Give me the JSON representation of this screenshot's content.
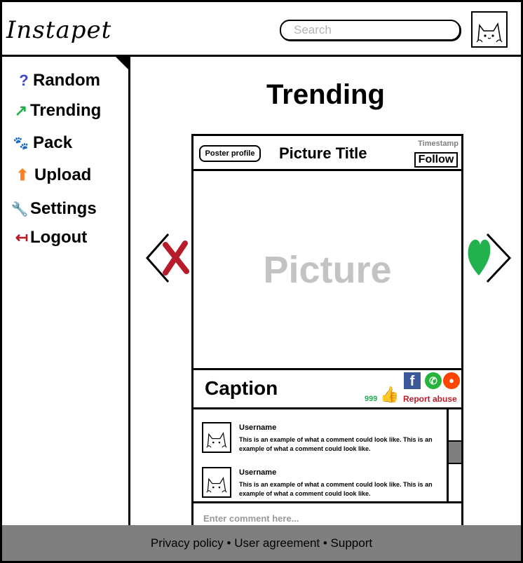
{
  "header": {
    "logo": "Instapet",
    "search_placeholder": "Search"
  },
  "sidebar": {
    "items": [
      {
        "label": "Random",
        "icon": "question-icon",
        "glyph": "?",
        "color": "#3f48cc"
      },
      {
        "label": "Trending",
        "icon": "trending-arrow-icon",
        "glyph": "↗",
        "color": "#22b14c"
      },
      {
        "label": "Pack",
        "icon": "paw-icon",
        "glyph": "🐾",
        "color": "#000000"
      },
      {
        "label": "Upload",
        "icon": "upload-arrow-icon",
        "glyph": "⬆",
        "color": "#ff7f27"
      },
      {
        "label": "Settings",
        "icon": "wrench-icon",
        "glyph": "🔧",
        "color": "#7f7f7f"
      },
      {
        "label": "Logout",
        "icon": "logout-arrow-icon",
        "glyph": "↤",
        "color": "#b61c2a"
      }
    ]
  },
  "main": {
    "title": "Trending"
  },
  "post": {
    "poster_label": "Poster profile",
    "title": "Picture Title",
    "timestamp": "Timestamp",
    "follow_label": "Follow",
    "picture_placeholder": "Picture",
    "caption": "Caption",
    "likes": "999",
    "report_label": "Report abuse",
    "share": {
      "facebook": "f",
      "whatsapp": "✆",
      "reddit": "●"
    },
    "comments": [
      {
        "username": "Username",
        "text": "This is an example of what a comment could look like. This is an example of what a comment could look like."
      },
      {
        "username": "Username",
        "text": "This is an example of what a comment could look like. This is an example of what a comment could look like."
      }
    ],
    "comment_placeholder": "Enter comment here..."
  },
  "colors": {
    "dislike": "#b61c2a",
    "like": "#22b14c",
    "footer_bg": "#7f7f7f"
  },
  "footer": {
    "links": [
      "Privacy policy",
      "User agreement",
      "Support"
    ],
    "separator": "•"
  }
}
